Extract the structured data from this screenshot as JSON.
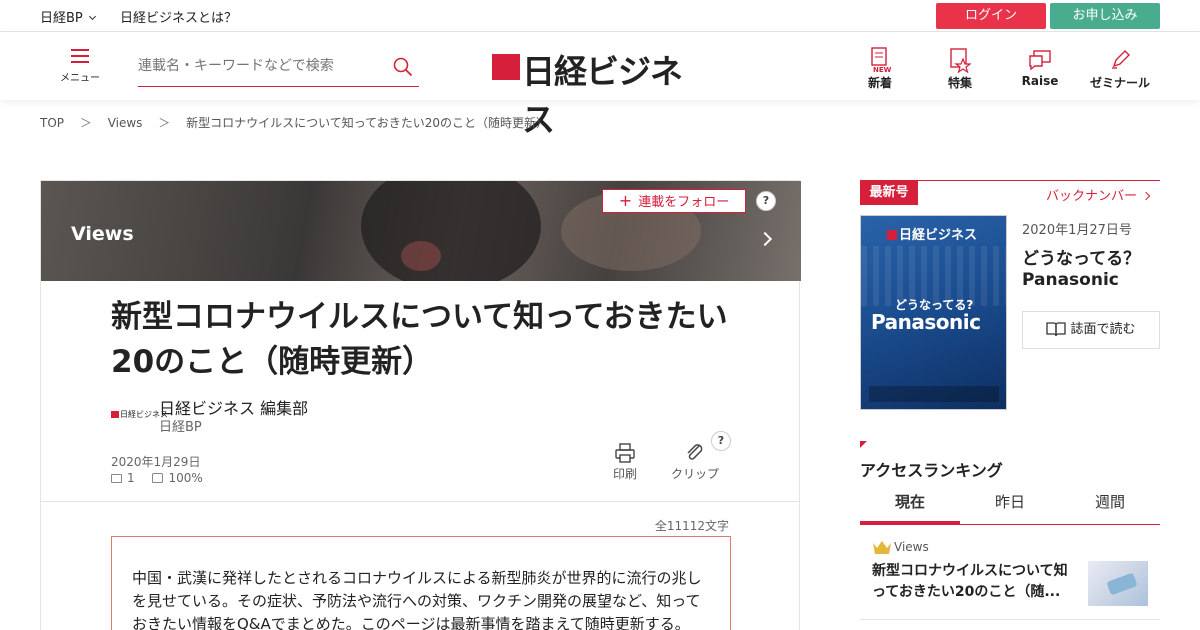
{
  "topbar": {
    "brand_menu": "日経BP",
    "about": "日経ビジネスとは？",
    "login": "ログイン",
    "apply": "お申し込み"
  },
  "header": {
    "menu_label": "メニュー",
    "search_placeholder": "連載名・キーワードなどで検索",
    "logo_text": "日経ビジネス",
    "nav": [
      {
        "label": "新着",
        "icon": "new-articles-icon"
      },
      {
        "label": "特集",
        "icon": "feature-icon"
      },
      {
        "label": "Raise",
        "icon": "raise-chat-icon"
      },
      {
        "label": "ゼミナール",
        "icon": "seminar-pen-icon"
      }
    ]
  },
  "breadcrumb": {
    "items": [
      "TOP",
      "Views",
      "新型コロナウイルスについて知っておきたい20のこと（随時更新）"
    ],
    "separator": "＞"
  },
  "article": {
    "series": "Views",
    "follow_label": "連載をフォロー",
    "help": "?",
    "title": "新型コロナウイルスについて知っておきたい20のこと（随時更新）",
    "author_logo_text": "日経ビジネス",
    "author_name": "日経ビジネス 編集部",
    "author_org": "日経BP",
    "date": "2020年1月29日",
    "comments": "1",
    "likes": "100%",
    "print_label": "印刷",
    "clip_label": "クリップ",
    "char_count": "全11112文字",
    "summary": "中国・武漢に発祥したとされるコロナウイルスによる新型肺炎が世界的に流行の兆しを見せている。その症状、予防法や流行への対策、ワクチン開発の展望など、知っておきたい情報をQ&Aでまとめた。このページは最新事情を踏まえて随時更新する。"
  },
  "sidebar": {
    "latest_tag": "最新号",
    "back_numbers": "バックナンバー",
    "cover": {
      "logo": "日経ビジネス",
      "question": "どうなってる?",
      "headline": "Panasonic"
    },
    "issue_date": "2020年1月27日号",
    "issue_title_line1": "どうなってる？",
    "issue_title_line2": "Panasonic",
    "read_button": "誌面で読む",
    "ranking_title": "アクセスランキング",
    "tabs": [
      "現在",
      "昨日",
      "週間"
    ],
    "active_tab": "現在",
    "ranking": [
      {
        "category": "Views",
        "title": "新型コロナウイルスについて知っておきたい20のこと（随..."
      }
    ]
  },
  "colors": {
    "brand_red": "#d6203b",
    "login_bg": "#e8334a",
    "apply_bg": "#4aac8e"
  }
}
